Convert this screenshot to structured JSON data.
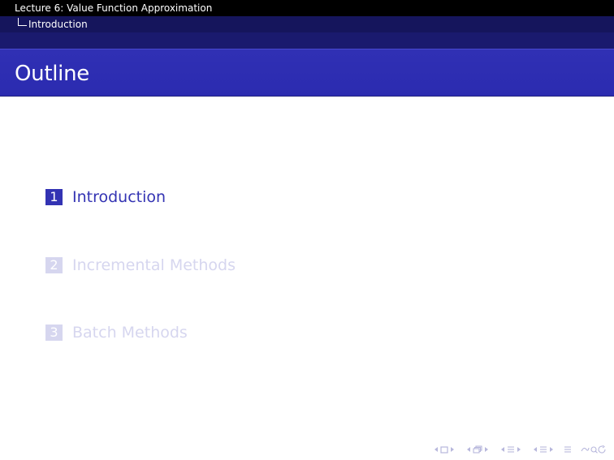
{
  "header": {
    "lecture_title": "Lecture 6: Value Function Approximation",
    "section_title": "Introduction"
  },
  "frame": {
    "title": "Outline"
  },
  "outline": {
    "items": [
      {
        "number": "1",
        "label": "Introduction",
        "state": "active"
      },
      {
        "number": "2",
        "label": "Incremental Methods",
        "state": "inactive"
      },
      {
        "number": "3",
        "label": "Batch Methods",
        "state": "inactive"
      }
    ]
  },
  "navigation": {
    "icons": [
      "frame-nav-icon",
      "subsection-nav-icon",
      "section-nav-icon",
      "subsubsection-nav-icon",
      "toc-nav-icon",
      "search-nav-icon"
    ]
  },
  "colors": {
    "header_black": "#000000",
    "header_dark_blue": "#15155c",
    "title_blue": "#2f2fb3",
    "active_blue": "#3333b3",
    "inactive_blue": "#d6d6ef",
    "nav_icon": "#b7b7dc"
  }
}
